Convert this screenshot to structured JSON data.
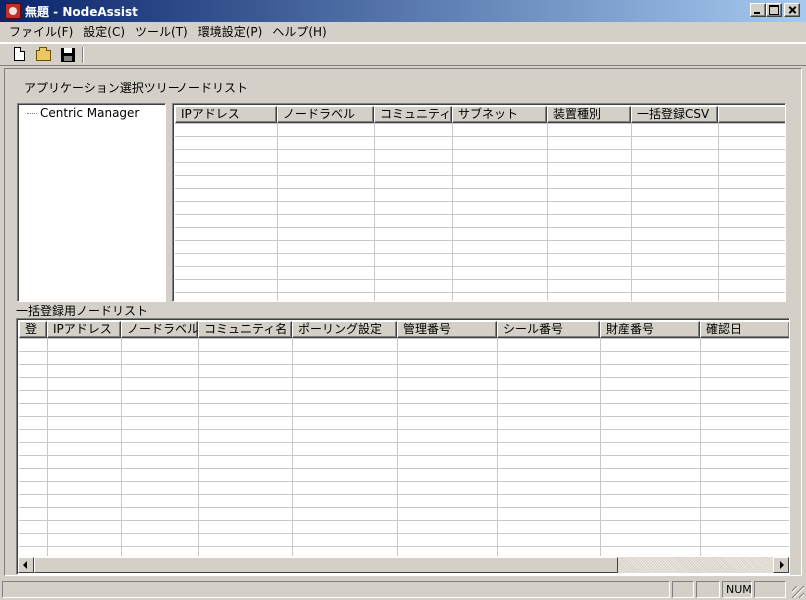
{
  "window": {
    "title": "無題 - NodeAssist"
  },
  "menu": [
    {
      "label": "ファイル(F)"
    },
    {
      "label": "設定(C)"
    },
    {
      "label": "ツール(T)"
    },
    {
      "label": "環境設定(P)"
    },
    {
      "label": "ヘルプ(H)"
    }
  ],
  "toolbar": {
    "new_icon": "new-document-icon",
    "open_icon": "open-folder-icon",
    "save_icon": "save-disk-icon"
  },
  "tree": {
    "label": "アプリケーション選択ツリー",
    "items": [
      "Centric Manager"
    ]
  },
  "nodelist": {
    "label": "ノードリスト",
    "columns": [
      "IPアドレス",
      "ノードラベル",
      "コミュニティ",
      "サブネット",
      "装置種別",
      "一括登録CSV",
      ""
    ]
  },
  "bulklist": {
    "label": "一括登録用ノードリスト",
    "columns": [
      "登",
      "IPアドレス",
      "ノードラベル",
      "コミュニティ名",
      "ポーリング設定",
      "管理番号",
      "シール番号",
      "財産番号",
      "確認日"
    ]
  },
  "statusbar": {
    "main": "",
    "num": "NUM"
  }
}
